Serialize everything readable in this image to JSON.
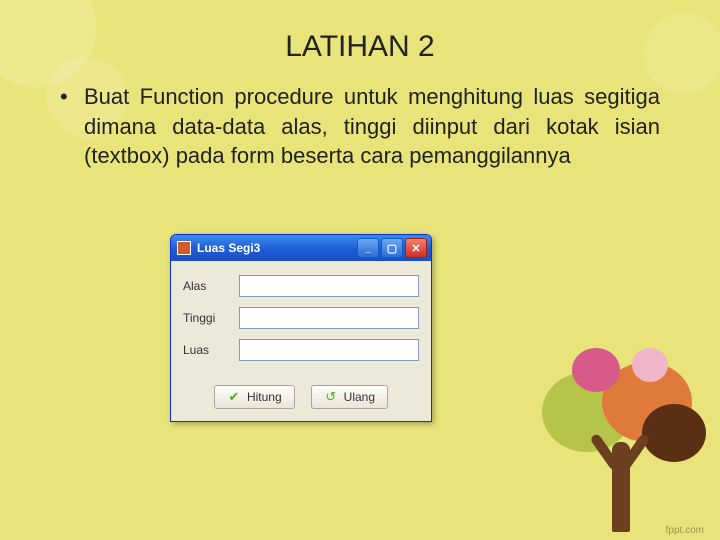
{
  "title": "LATIHAN 2",
  "bullet_text": "Buat Function procedure untuk menghitung luas segitiga dimana data-data alas, tinggi diinput dari kotak isian (textbox) pada form beserta cara pemanggilannya",
  "window": {
    "title": "Luas Segi3",
    "fields": {
      "alas": {
        "label": "Alas",
        "value": ""
      },
      "tinggi": {
        "label": "Tinggi",
        "value": ""
      },
      "luas": {
        "label": "Luas",
        "value": ""
      }
    },
    "buttons": {
      "hitung": "Hitung",
      "ulang": "Ulang"
    }
  },
  "footer": "fppt.com"
}
